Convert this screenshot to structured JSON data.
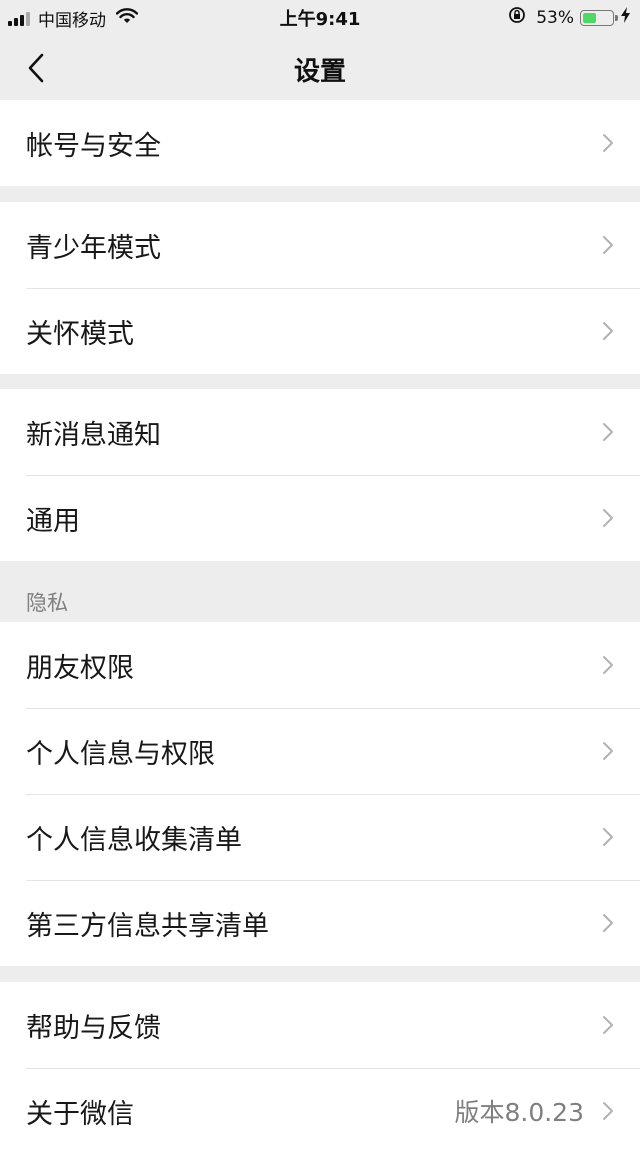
{
  "status_bar": {
    "carrier": "中国移动",
    "time": "上午9:41",
    "battery": "53%",
    "battery_level": 0.53
  },
  "nav": {
    "title": "设置"
  },
  "groups": [
    {
      "items": [
        {
          "label": "帐号与安全"
        }
      ]
    },
    {
      "items": [
        {
          "label": "青少年模式"
        },
        {
          "label": "关怀模式"
        }
      ]
    },
    {
      "items": [
        {
          "label": "新消息通知"
        },
        {
          "label": "通用"
        }
      ]
    },
    {
      "header": "隐私",
      "items": [
        {
          "label": "朋友权限"
        },
        {
          "label": "个人信息与权限"
        },
        {
          "label": "个人信息收集清单"
        },
        {
          "label": "第三方信息共享清单"
        }
      ]
    },
    {
      "items": [
        {
          "label": "帮助与反馈"
        },
        {
          "label": "关于微信",
          "value": "版本8.0.23"
        }
      ]
    }
  ],
  "colors": {
    "background": "#ededed",
    "row_background": "#ffffff",
    "secondary_text": "#7f7f7f",
    "battery_green": "#4cd964"
  }
}
